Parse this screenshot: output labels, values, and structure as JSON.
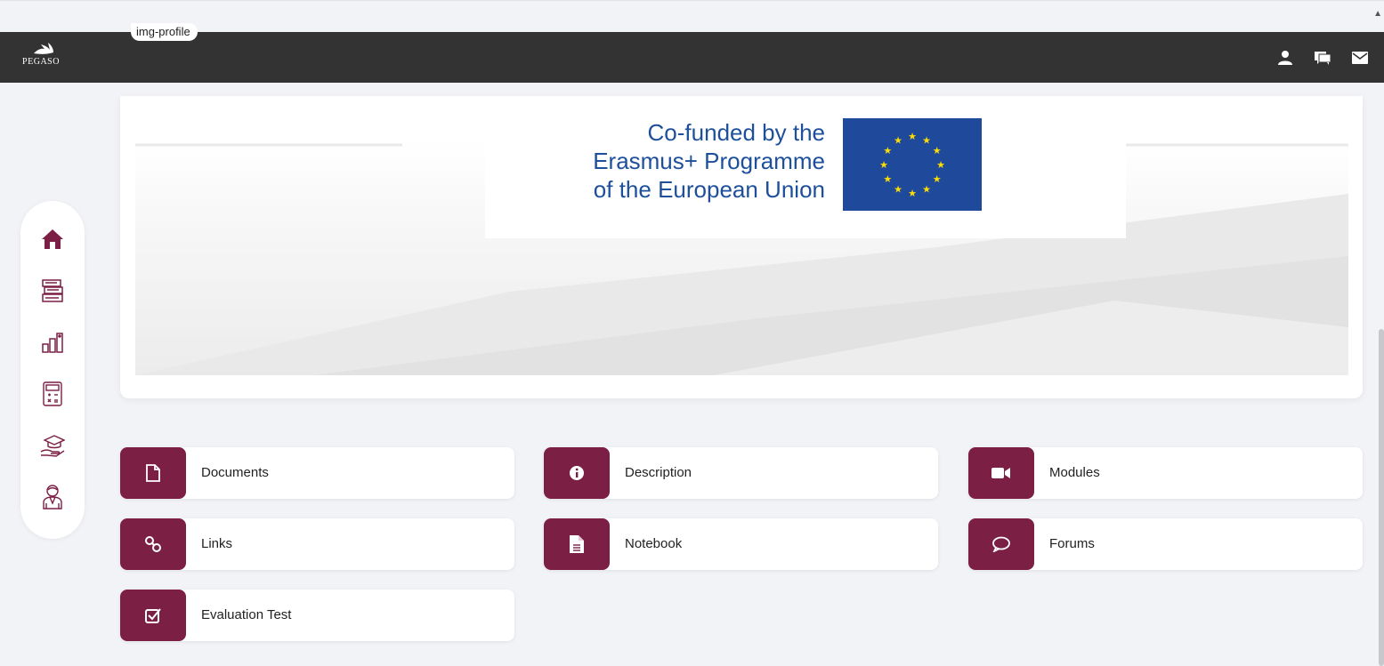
{
  "header": {
    "logo_text": "PEGASO",
    "profile_label": "img-profile",
    "icons": [
      "user-icon",
      "chat-icon",
      "mail-icon"
    ]
  },
  "sidebar": {
    "items": [
      "home-icon",
      "courses-icon",
      "statistics-icon",
      "calculator-icon",
      "graduation-icon",
      "tutor-icon"
    ]
  },
  "banner": {
    "line1": "Co-funded by the",
    "line2": "Erasmus+ Programme",
    "line3": "of the European Union"
  },
  "tiles": [
    {
      "label": "Documents",
      "icon": "document-icon"
    },
    {
      "label": "Description",
      "icon": "info-icon"
    },
    {
      "label": "Modules",
      "icon": "video-icon"
    },
    {
      "label": "Links",
      "icon": "link-icon"
    },
    {
      "label": "Notebook",
      "icon": "notebook-icon"
    },
    {
      "label": "Forums",
      "icon": "forum-icon"
    },
    {
      "label": "Evaluation Test",
      "icon": "checkbox-icon"
    }
  ],
  "colors": {
    "header_bg": "#333333",
    "accent": "#7b1f45",
    "eu_blue": "#1f4a9c",
    "eu_star": "#ffdd00",
    "sidebar_icon": "#7b1f45"
  }
}
